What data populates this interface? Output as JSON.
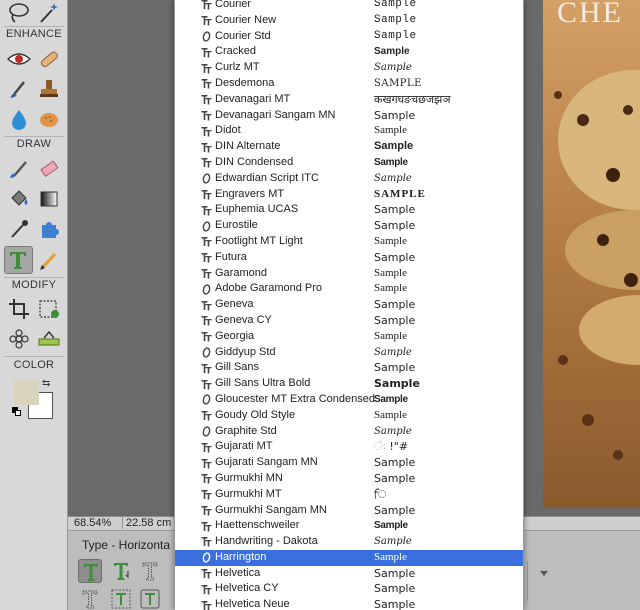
{
  "toolbox": {
    "sections": {
      "enhance": "ENHANCE",
      "draw": "DRAW",
      "modify": "MODIFY",
      "color": "COLOR"
    },
    "colors": {
      "foreground": "#d8d3bd",
      "background": "#ffffff"
    }
  },
  "status_bar": {
    "zoom": "68.54%",
    "size": "22.58 cm"
  },
  "options_bar": {
    "type_label": "Type - Horizonta"
  },
  "canvas": {
    "photo_title": "CHE"
  },
  "font_menu": {
    "selected_color": "#3a6fe0",
    "fonts": [
      {
        "name": "Courier",
        "sample": "Sample",
        "icon": "truetype-icon",
        "sample_style": "mono"
      },
      {
        "name": "Courier New",
        "sample": "Sample",
        "icon": "truetype-icon",
        "sample_style": "mono"
      },
      {
        "name": "Courier Std",
        "sample": "Sample",
        "icon": "opentype-icon",
        "sample_style": "mono"
      },
      {
        "name": "Cracked",
        "sample": "Sample",
        "icon": "truetype-icon",
        "sample_style": "heavy"
      },
      {
        "name": "Curlz MT",
        "sample": "Sample",
        "icon": "truetype-icon",
        "sample_style": "script"
      },
      {
        "name": "Desdemona",
        "sample": "SAMPLE",
        "icon": "truetype-icon",
        "sample_style": "caps"
      },
      {
        "name": "Devanagari MT",
        "sample": "कखगघङचछजझञ",
        "icon": "truetype-icon",
        "sample_style": "plain"
      },
      {
        "name": "Devanagari Sangam MN",
        "sample": "Sample",
        "icon": "truetype-icon",
        "sample_style": "plain"
      },
      {
        "name": "Didot",
        "sample": "Sample",
        "icon": "truetype-icon",
        "sample_style": "serif"
      },
      {
        "name": "DIN Alternate",
        "sample": "Sample",
        "icon": "truetype-icon",
        "sample_style": "bold"
      },
      {
        "name": "DIN Condensed",
        "sample": "Sample",
        "icon": "truetype-icon",
        "sample_style": "condensed"
      },
      {
        "name": "Edwardian Script ITC",
        "sample": "Sample",
        "icon": "opentype-icon",
        "sample_style": "script"
      },
      {
        "name": "Engravers MT",
        "sample": "SAMPLE",
        "icon": "truetype-icon",
        "sample_style": "engraved"
      },
      {
        "name": "Euphemia UCAS",
        "sample": "Sample",
        "icon": "truetype-icon",
        "sample_style": "plain"
      },
      {
        "name": "Eurostile",
        "sample": "Sample",
        "icon": "opentype-icon",
        "sample_style": "plain"
      },
      {
        "name": "Footlight MT Light",
        "sample": "Sample",
        "icon": "truetype-icon",
        "sample_style": "serif"
      },
      {
        "name": "Futura",
        "sample": "Sample",
        "icon": "truetype-icon",
        "sample_style": "plain"
      },
      {
        "name": "Garamond",
        "sample": "Sample",
        "icon": "truetype-icon",
        "sample_style": "serif"
      },
      {
        "name": "Adobe Garamond Pro",
        "sample": "Sample",
        "icon": "opentype-icon",
        "sample_style": "serif"
      },
      {
        "name": "Geneva",
        "sample": "Sample",
        "icon": "truetype-icon",
        "sample_style": "plain"
      },
      {
        "name": "Geneva CY",
        "sample": "Sample",
        "icon": "truetype-icon",
        "sample_style": "plain"
      },
      {
        "name": "Georgia",
        "sample": "Sample",
        "icon": "truetype-icon",
        "sample_style": "serif"
      },
      {
        "name": "Giddyup Std",
        "sample": "Sample",
        "icon": "opentype-icon",
        "sample_style": "script"
      },
      {
        "name": "Gill Sans",
        "sample": "Sample",
        "icon": "truetype-icon",
        "sample_style": "plain"
      },
      {
        "name": "Gill Sans Ultra Bold",
        "sample": "Sample",
        "icon": "truetype-icon",
        "sample_style": "black"
      },
      {
        "name": "Gloucester MT Extra Condensed",
        "sample": "Sample",
        "icon": "opentype-icon",
        "sample_style": "condensed"
      },
      {
        "name": "Goudy Old Style",
        "sample": "Sample",
        "icon": "truetype-icon",
        "sample_style": "serif"
      },
      {
        "name": "Graphite Std",
        "sample": "Sample",
        "icon": "opentype-icon",
        "sample_style": "script"
      },
      {
        "name": "Gujarati MT",
        "sample": "ંઃ !\"#",
        "icon": "truetype-icon",
        "sample_style": "plain"
      },
      {
        "name": "Gujarati Sangam MN",
        "sample": "Sample",
        "icon": "truetype-icon",
        "sample_style": "plain"
      },
      {
        "name": "Gurmukhi MN",
        "sample": "Sample",
        "icon": "truetype-icon",
        "sample_style": "plain"
      },
      {
        "name": "Gurmukhi MT",
        "sample": "ਿ",
        "icon": "truetype-icon",
        "sample_style": "plain"
      },
      {
        "name": "Gurmukhi Sangam MN",
        "sample": "Sample",
        "icon": "truetype-icon",
        "sample_style": "plain"
      },
      {
        "name": "Haettenschweiler",
        "sample": "Sample",
        "icon": "truetype-icon",
        "sample_style": "condensed"
      },
      {
        "name": "Handwriting - Dakota",
        "sample": "Sample",
        "icon": "truetype-icon",
        "sample_style": "script"
      },
      {
        "name": "Harrington",
        "sample": "Sample",
        "icon": "opentype-icon",
        "sample_style": "serif",
        "selected": true
      },
      {
        "name": "Helvetica",
        "sample": "Sample",
        "icon": "truetype-icon",
        "sample_style": "plain"
      },
      {
        "name": "Helvetica CY",
        "sample": "Sample",
        "icon": "truetype-icon",
        "sample_style": "plain"
      },
      {
        "name": "Helvetica Neue",
        "sample": "Sample",
        "icon": "truetype-icon",
        "sample_style": "plain"
      }
    ]
  }
}
